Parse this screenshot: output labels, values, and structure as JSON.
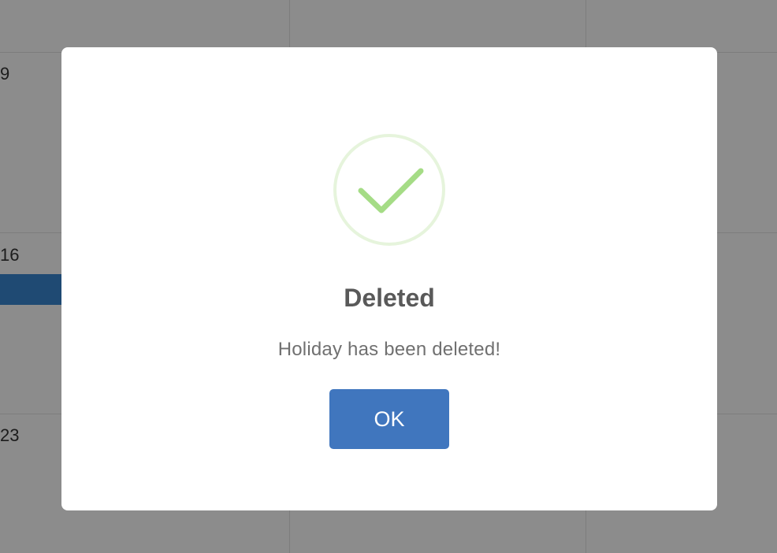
{
  "calendar": {
    "day_numbers": [
      "9",
      "16",
      "23"
    ]
  },
  "dialog": {
    "icon": "success-check-icon",
    "title": "Deleted",
    "message": "Holiday has been deleted!",
    "ok_label": "OK"
  },
  "colors": {
    "overlay": "#8c8c8c",
    "dialog_bg": "#ffffff",
    "success_green": "#a5dc86",
    "button_blue": "#4076be",
    "event_bar": "#1f4a73"
  }
}
